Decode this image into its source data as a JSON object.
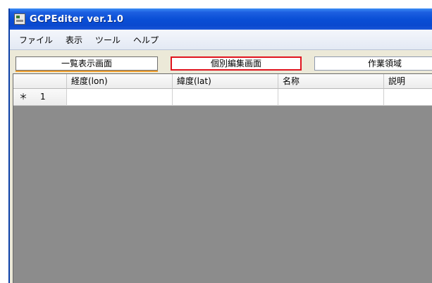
{
  "window": {
    "title": "GCPEditer ver.1.0"
  },
  "menu": {
    "items": [
      "ファイル",
      "表示",
      "ツール",
      "ヘルプ"
    ]
  },
  "tabs": {
    "items": [
      "一覧表示画面",
      "個別編集画面",
      "作業領域"
    ],
    "active_index": 0,
    "highlighted_index": 1,
    "highlight_color": "#e0141e"
  },
  "grid": {
    "columns": [
      "経度(lon)",
      "緯度(lat)",
      "名称",
      "説明"
    ],
    "new_row_marker": "＊",
    "row_number": "1",
    "background_color": "#8c8c8c"
  },
  "icons": {
    "app": "app-icon"
  }
}
